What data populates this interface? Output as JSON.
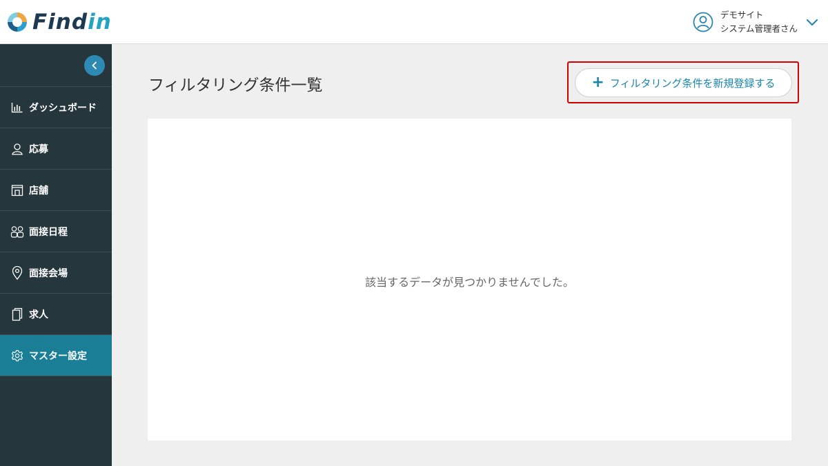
{
  "header": {
    "logo_text_main": "Find",
    "logo_text_accent": "in",
    "user": {
      "site_name": "デモサイト",
      "role_name": "システム管理者さん"
    }
  },
  "sidebar": {
    "items": [
      {
        "label": "ダッシュボード",
        "icon": "chart-icon"
      },
      {
        "label": "応募",
        "icon": "person-icon"
      },
      {
        "label": "店舗",
        "icon": "store-icon"
      },
      {
        "label": "面接日程",
        "icon": "people-icon"
      },
      {
        "label": "面接会場",
        "icon": "location-pin-icon"
      },
      {
        "label": "求人",
        "icon": "document-icon"
      },
      {
        "label": "マスター設定",
        "icon": "gear-icon",
        "active": true
      }
    ]
  },
  "main": {
    "title": "フィルタリング条件一覧",
    "add_button_label": "フィルタリング条件を新規登録する",
    "empty_message": "該当するデータが見つかりませんでした。"
  },
  "colors": {
    "sidebar_bg": "#26363d",
    "active_item_bg": "#1a7f96",
    "accent": "#1a86ab",
    "highlight_border": "#d40000"
  }
}
